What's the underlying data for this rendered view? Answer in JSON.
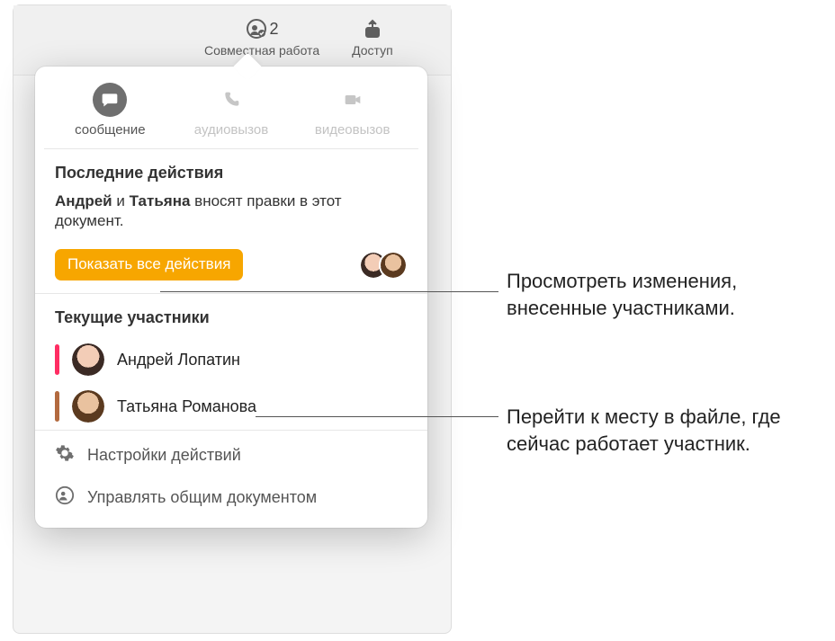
{
  "toolbar": {
    "collaborate": {
      "label": "Совместная работа",
      "badge": "2"
    },
    "share": {
      "label": "Доступ"
    }
  },
  "popover": {
    "comm": {
      "message": "сообщение",
      "audio": "аудиовызов",
      "video": "видеовызов"
    },
    "recent_header": "Последние действия",
    "recent_sentence": {
      "p1": "Андрей",
      "mid": " и ",
      "p2": "Татьяна",
      "rest": " вносят правки в этот документ."
    },
    "show_all": "Показать все действия",
    "participants_header": "Текущие участники",
    "participants": [
      {
        "name": "Андрей Лопатин",
        "color": "#ff2d63"
      },
      {
        "name": "Татьяна Романова",
        "color": "#b36a3f"
      }
    ],
    "settings": [
      "Настройки действий",
      "Управлять общим документом"
    ]
  },
  "callouts": {
    "c1": "Просмотреть изменения, внесенные участниками.",
    "c2": "Перейти к месту в файле, где сейчас работает участник."
  }
}
